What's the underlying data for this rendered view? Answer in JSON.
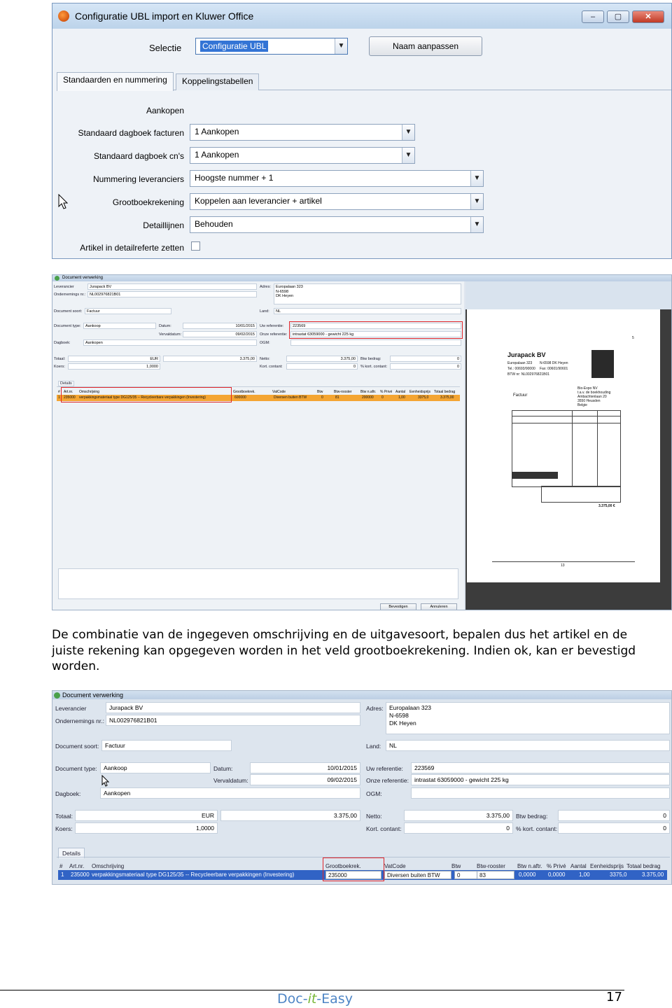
{
  "screenshot1": {
    "window_title": "Configuratie UBL import en Kluwer Office",
    "window_buttons": {
      "minimize": "–",
      "maximize": "▢",
      "close": "✕"
    },
    "selectie_label": "Selectie",
    "selectie_value": "Configuratie UBL",
    "naam_button": "Naam aanpassen",
    "tabs": [
      "Standaarden en nummering",
      "Koppelingstabellen"
    ],
    "section_heading": "Aankopen",
    "fields": [
      {
        "label": "Standaard dagboek facturen",
        "value": "1 Aankopen"
      },
      {
        "label": "Standaard dagboek cn's",
        "value": "1 Aankopen"
      },
      {
        "label": "Nummering leveranciers",
        "value": "Hoogste nummer + 1"
      },
      {
        "label": "Grootboekrekening",
        "value": "Koppelen aan leverancier + artikel"
      },
      {
        "label": "Detaillijnen",
        "value": "Behouden"
      }
    ],
    "checkbox_label": "Artikel in detailreferte zetten"
  },
  "screenshot2": {
    "window_title": "Document verwerking",
    "labels": {
      "leverancier": "Leverancier",
      "ondernemings": "Ondernemings nr.:",
      "document_soort": "Document soort:",
      "adres": "Adres:",
      "land": "Land:",
      "document_type": "Document type:",
      "datum": "Datum:",
      "vervaldatum": "Vervaldatum:",
      "uw_referentie": "Uw referentie:",
      "onze_referentie": "Onze referentie:",
      "dagboek": "Dagboek:",
      "ogm": "OGM:",
      "totaal": "Totaal:",
      "koers": "Koers:",
      "netto": "Netto:",
      "kort_contant": "Kort. contant:",
      "btw_bedrag": "Btw bedrag:",
      "pct_kort_contant": "% kort. contant:",
      "details_tab": "Details"
    },
    "values": {
      "leverancier": "Jurapack BV",
      "ondernemings": "NL002976821B01",
      "document_soort": "Factuur",
      "adres_lines": [
        "Europalaan 323",
        "N-6598",
        "DK Heyen"
      ],
      "land": "NL",
      "document_type": "Aankoop",
      "datum": "10/01/2015",
      "vervaldatum": "09/02/2015",
      "uw_referentie": "223569",
      "onze_referentie": "intrastat 63059000 - gewicht 225 kg",
      "dagboek": "Aankopen",
      "totaal_cur": "EUR",
      "totaal": "3.375,00",
      "koers": "1,0000",
      "netto": "3.375,00",
      "kort_contant": "0",
      "btw_bedrag": "0",
      "pct_kort_contant": "0"
    },
    "grid_headers": [
      "#",
      "Art.nr.",
      "Omschrijving",
      "Grootboekrek.",
      "VatCode",
      "Btw",
      "Btw-rooster",
      "Btw n.aftr.",
      "% Privé",
      "Aantal",
      "Eenheidsprijs",
      "Totaal bedrag"
    ],
    "grid_row": [
      "1",
      "235000",
      "verpakkingsmateriaal type DG125/35 -- Recycleerbare verpakkingen (Investering)",
      "600000",
      "Diversen buiten BTW",
      "0",
      "81",
      "200000",
      "0",
      "1,00",
      "3375,0",
      "3.375,00"
    ],
    "buttons": {
      "bevestigen": "Bevestigen",
      "annuleren": "Annuleren"
    },
    "invoice": {
      "company": "Jurapack BV",
      "address": [
        "Europalaan 323",
        "N-6598 DK Heyen"
      ],
      "phone": "Tel.: 00693/90000",
      "fax": "Fax: 00601/90601",
      "btw": "BTW nr: NL002976821B01",
      "page_top": "5",
      "doc_title": "Factuur",
      "recipient": [
        "Bio-Expo NV",
        "t.a.v. de boekhouding",
        "Ambachtenlaan 20",
        "3550 Heusden",
        "Belgie"
      ],
      "total": "3.375,00 €",
      "page_bottom": "13"
    }
  },
  "paragraph": "De combinatie van de ingegeven omschrijving en de uitgavesoort, bepalen dus het artikel en de juiste rekening kan opgegeven worden in het veld grootboekrekening. Indien ok, kan er bevestigd worden.",
  "screenshot3": {
    "window_title": "Document verwerking",
    "labels": {
      "leverancier": "Leverancier",
      "ondernemings": "Ondernemings nr.:",
      "document_soort": "Document soort:",
      "adres": "Adres:",
      "land": "Land:",
      "document_type": "Document type:",
      "datum": "Datum:",
      "vervaldatum": "Vervaldatum:",
      "uw_referentie": "Uw referentie:",
      "onze_referentie": "Onze referentie:",
      "dagboek": "Dagboek:",
      "ogm": "OGM:",
      "totaal": "Totaal:",
      "koers": "Koers:",
      "netto": "Netto:",
      "kort_contant": "Kort. contant:",
      "btw_bedrag": "Btw bedrag:",
      "pct_kort_contant": "% kort. contant:",
      "details_tab": "Details"
    },
    "values": {
      "leverancier": "Jurapack BV",
      "ondernemings": "NL002976821B01",
      "document_soort": "Factuur",
      "adres_lines": [
        "Europalaan 323",
        "N-6598",
        "DK Heyen"
      ],
      "land": "NL",
      "document_type": "Aankoop",
      "datum": "10/01/2015",
      "vervaldatum": "09/02/2015",
      "uw_referentie": "223569",
      "onze_referentie": "intrastat 63059000 - gewicht 225 kg",
      "dagboek": "Aankopen",
      "totaal_cur": "EUR",
      "totaal": "3.375,00",
      "koers": "1,0000",
      "netto": "3.375,00",
      "kort_contant": "0",
      "btw_bedrag": "0",
      "pct_kort_contant": "0"
    },
    "grid_headers": [
      "#",
      "Art.nr.",
      "Omschrijving",
      "Grootboekrek.",
      "VatCode",
      "Btw",
      "Btw-rooster",
      "Btw n.aftr.",
      "% Privé",
      "Aantal",
      "Eenheidsprijs",
      "Totaal bedrag"
    ],
    "grid_row": [
      "1",
      "235000",
      "verpakkingsmateriaal type DG125/35 -- Recycleerbare verpakkingen (Investering)",
      "235000",
      "Diversen buiten BTW",
      "0",
      "83",
      "0,0000",
      "0,0000",
      "1,00",
      "3375,0",
      "3.375,00"
    ]
  },
  "footer": {
    "brand_left": "Doc-",
    "brand_mid": "it",
    "brand_right": "-Easy",
    "page_number": "17"
  },
  "colors": {
    "highlight_red": "#e0262b",
    "selection_blue": "#3163c5",
    "brand_blue": "#4f86c6",
    "brand_green": "#79b83a",
    "row_orange": "#f4a532"
  }
}
